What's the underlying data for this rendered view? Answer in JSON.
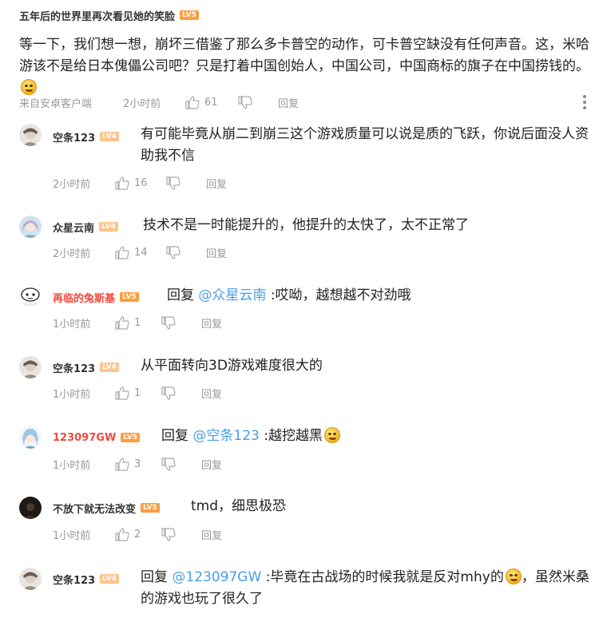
{
  "post": {
    "author": "五年后的世界里再次看见她的笑脸",
    "level": "LV5",
    "text": "等一下，我们想一想，崩坏三借鉴了那么多卡普空的动作，可卡普空缺没有任何声音。这，米哈游该不是给日本傀儡公司吧？只是打着中国创始人，中国公司，中国商标的旗子在中国捞钱的。",
    "source": "来自安卓客户端",
    "time": "2小时前",
    "likes": "61",
    "reply_label": "回复"
  },
  "replies": [
    {
      "name": "空条123",
      "level": "LV4",
      "prefix": "",
      "mention": "",
      "suffix": "",
      "text": "有可能毕竟从崩二到崩三这个游戏质量可以说是质的飞跃，你说后面没人资助我不信",
      "time": "2小时前",
      "likes": "16",
      "reply_label": "回复"
    },
    {
      "name": "众星云南",
      "level": "LV4",
      "prefix": "",
      "mention": "",
      "suffix": "",
      "text": "技术不是一时能提升的，他提升的太快了，太不正常了",
      "time": "2小时前",
      "likes": "14",
      "reply_label": "回复"
    },
    {
      "name": "再临的兔斯基",
      "level": "LV5",
      "prefix": "回复",
      "mention": "@众星云南",
      "suffix": ":哎呦，越想越不对劲哦",
      "text": "",
      "time": "1小时前",
      "likes": "1",
      "reply_label": "回复"
    },
    {
      "name": "空条123",
      "level": "LV4",
      "prefix": "",
      "mention": "",
      "suffix": "",
      "text": "从平面转向3D游戏难度很大的",
      "time": "1小时前",
      "likes": "1",
      "reply_label": "回复"
    },
    {
      "name": "123097GW",
      "level": "LV5",
      "prefix": "回复",
      "mention": "@空条123",
      "suffix": ":越挖越黑",
      "text": "",
      "time": "1小时前",
      "likes": "3",
      "reply_label": "回复"
    },
    {
      "name": "不放下就无法改变",
      "level": "LV5",
      "prefix": "",
      "mention": "",
      "suffix": "",
      "text": "tmd，细思极恐",
      "time": "1小时前",
      "likes": "2",
      "reply_label": "回复"
    },
    {
      "name": "空条123",
      "level": "LV4",
      "prefix": "回复",
      "mention": "@123097GW",
      "suffix": ":毕竟在古战场的时候我就是反对mhy的",
      "text": "，虽然米桑的游戏也玩了很久了",
      "time": "",
      "likes": "",
      "reply_label": ""
    }
  ],
  "icons": {
    "like": "thumbs-up-icon",
    "dislike": "thumbs-down-icon",
    "more": "more-vertical-icon",
    "emoji": "smirk-emoji-icon"
  },
  "colors": {
    "mention": "#4a9de8",
    "red_name": "#f0493e",
    "lv5": "#ff9d3d",
    "lv4": "#ffc48a",
    "meta": "#999999"
  }
}
